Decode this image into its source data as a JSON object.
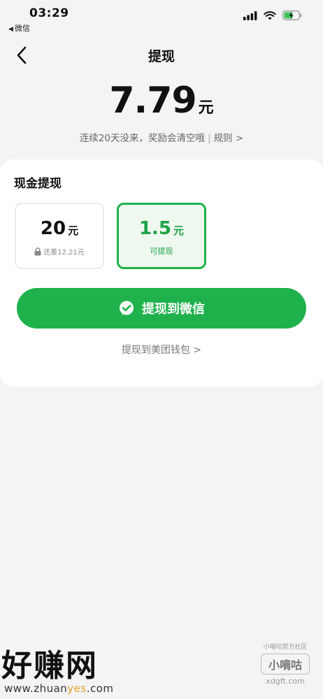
{
  "status_bar": {
    "time": "03:29",
    "back_app": "微信"
  },
  "nav": {
    "title": "提现"
  },
  "balance": {
    "value": "7.79",
    "unit": "元"
  },
  "notice": {
    "text": "连续20天没来，奖励会清空哦",
    "rules_label": "规则 >"
  },
  "cash": {
    "title": "现金提现",
    "options": [
      {
        "amount": "20",
        "unit": "元",
        "sub": "还差12.21元",
        "locked": true,
        "selected": false
      },
      {
        "amount": "1.5",
        "unit": "元",
        "sub": "可提现",
        "locked": false,
        "selected": true
      }
    ]
  },
  "actions": {
    "wechat_label": "提现到微信",
    "wallet_label": "提现到美团钱包 >"
  },
  "watermarks": {
    "left_big": "好赚网",
    "left_small_pre": "www.zhuan",
    "left_small_hl": "yes",
    "left_small_post": ".com",
    "right_top": "小嘀咕官方社区",
    "right_mid": "小嘀咕",
    "right_bot": "xdgft.com"
  },
  "colors": {
    "accent": "#1fb14b",
    "background": "#f4f4f4",
    "selected_bg": "#eef8ef"
  }
}
